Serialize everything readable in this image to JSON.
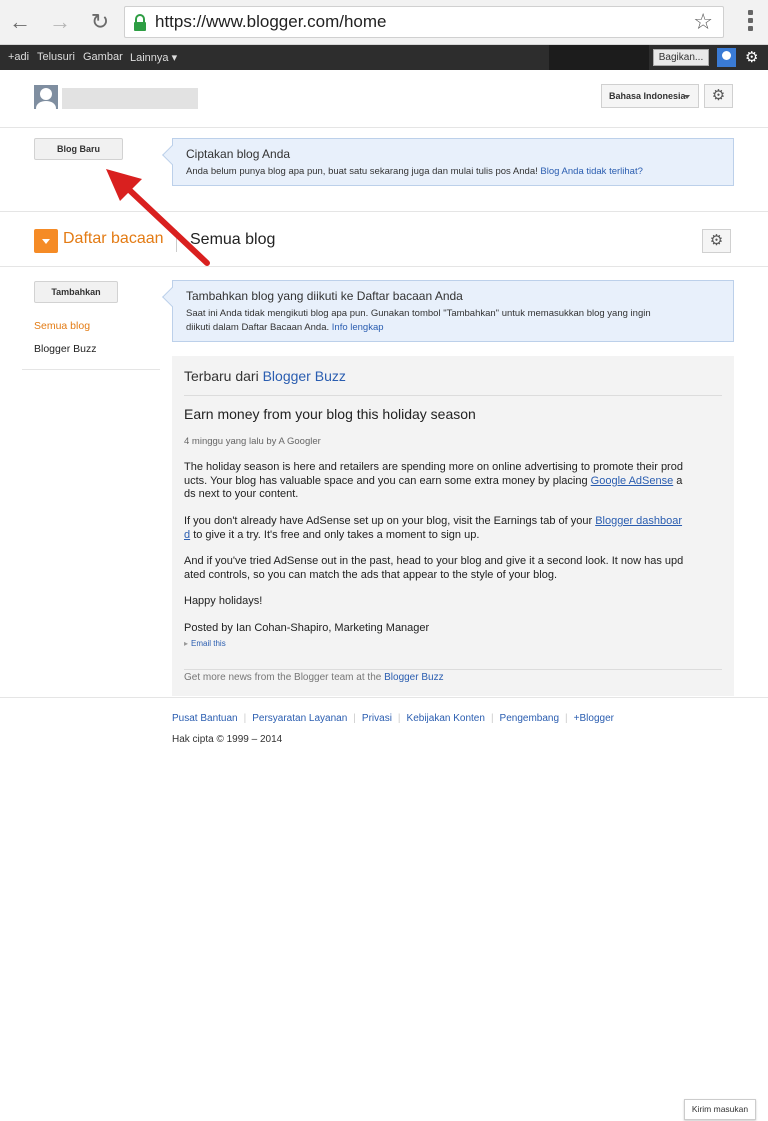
{
  "browser": {
    "url": "https://www.blogger.com/home"
  },
  "gbar": {
    "items": [
      "+adi",
      "Telusuri",
      "Gambar",
      "Lainnya ▾"
    ],
    "share_label": "Bagikan..."
  },
  "header": {
    "language": "Bahasa Indonesia"
  },
  "new_blog": {
    "button_label": "Blog Baru",
    "info_title": "Ciptakan blog Anda",
    "info_text": "Anda belum punya blog apa pun, buat satu sekarang juga dan mulai tulis pos Anda!",
    "info_link": "Blog Anda tidak terlihat?"
  },
  "reading_list": {
    "title": "Daftar bacaan",
    "subtitle": "Semua blog",
    "add_button": "Tambahkan",
    "sidebar": [
      "Semua blog",
      "Blogger Buzz"
    ],
    "info_title": "Tambahkan blog yang diikuti ke Daftar bacaan Anda",
    "info_line1": "Saat ini Anda tidak mengikuti blog apa pun. Gunakan tombol \"Tambahkan\" untuk memasukkan blog yang ingin",
    "info_line2": "diikuti dalam Daftar Bacaan Anda.",
    "info_link": "Info lengkap"
  },
  "post": {
    "panel_prefix": "Terbaru dari",
    "panel_blog": "Blogger Buzz",
    "title": "Earn money from your blog this holiday season",
    "meta": "4 minggu yang lalu by A Googler",
    "p1a": "The holiday season is here and retailers are spending more on online advertising to promote their prod",
    "p1b": "ucts. Your blog has valuable space and you can earn some extra money by placing",
    "p1_link": "Google AdSense",
    "p1c": "a",
    "p1d": "ds next to your content.",
    "p2a": "If you don't already have AdSense set up on your blog, visit the Earnings tab of your",
    "p2_link1": "Blogger dashboar",
    "p2_link2": "d",
    "p2b": "to give it a try. It's free and only takes a moment to sign up.",
    "p3a": "And if you've tried AdSense out in the past, head to your blog and give it a second look. It now has upd",
    "p3b": "ated controls, so you can match the ads that appear to the style of your blog.",
    "p4": "Happy holidays!",
    "p5": "Posted by Ian Cohan-Shapiro, Marketing Manager",
    "email_link": "Email this",
    "footer_text": "Get more news from the Blogger team at the",
    "footer_link": "Blogger Buzz"
  },
  "footer": {
    "links": [
      "Pusat Bantuan",
      "Persyaratan Layanan",
      "Privasi",
      "Kebijakan Konten",
      "Pengembang",
      "+Blogger"
    ],
    "copyright": "Hak cipta © 1999 – 2014",
    "feedback": "Kirim masukan"
  },
  "colors": {
    "accent_orange": "#e37b14",
    "link_blue": "#2a5db0",
    "arrow_red": "#d9201f"
  }
}
